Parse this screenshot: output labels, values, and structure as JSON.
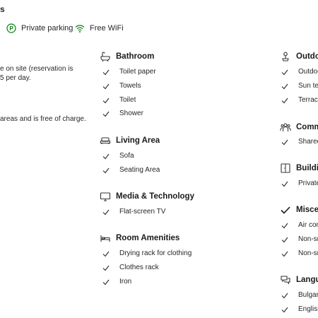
{
  "top": {
    "heading_fragment": "s",
    "facilities": [
      {
        "icon": "parking-icon",
        "label": "Private parking"
      },
      {
        "icon": "wifi-icon",
        "label": "Free WiFi"
      }
    ]
  },
  "left": {
    "line1": "e on site (reservation is",
    "line2": "5 per day.",
    "line3": "areas and is free of charge."
  },
  "mid_sections": [
    {
      "title": "Bathroom",
      "icon": "bath-icon",
      "items": [
        "Toilet paper",
        "Towels",
        "Toilet",
        "Shower"
      ]
    },
    {
      "title": "Living Area",
      "icon": "sofa-icon",
      "items": [
        "Sofa",
        "Seating Area"
      ]
    },
    {
      "title": "Media & Technology",
      "icon": "tv-icon",
      "items": [
        "Flat-screen TV"
      ]
    },
    {
      "title": "Room Amenities",
      "icon": "bed-icon",
      "items": [
        "Drying rack for clothing",
        "Clothes rack",
        "Iron"
      ]
    }
  ],
  "right_sections": [
    {
      "title": "Outdo",
      "icon": "plant-icon",
      "items": [
        "Outdoo",
        "Sun ter",
        "Terrace"
      ]
    },
    {
      "title": "Comm",
      "icon": "people-icon",
      "items": [
        "Shared"
      ]
    },
    {
      "title": "Buildi",
      "icon": "door-icon",
      "items": [
        "Private"
      ]
    },
    {
      "title": "Misce",
      "icon": "check-icon",
      "items": [
        "Air con",
        "Non-sm",
        "Non-sm"
      ]
    },
    {
      "title": "Langu",
      "icon": "speech-icon",
      "items": [
        "Bulgari",
        "English"
      ]
    }
  ],
  "colors": {
    "check": "#333333",
    "accent_green": "#008009"
  }
}
